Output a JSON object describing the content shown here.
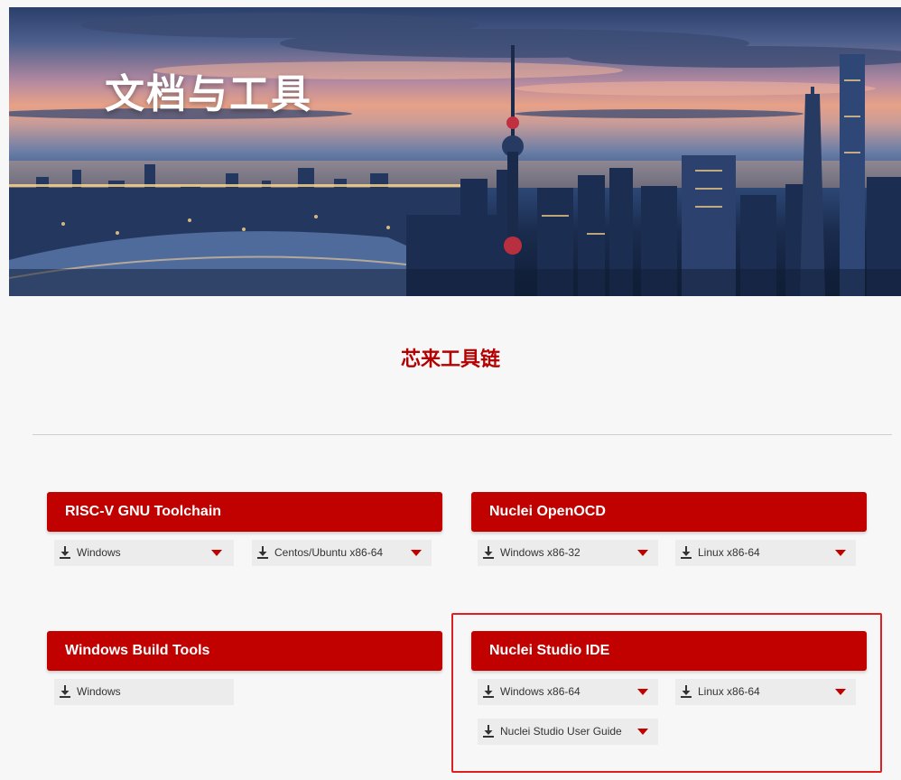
{
  "banner": {
    "title": "文档与工具"
  },
  "section": {
    "title": "芯来工具链"
  },
  "cards": {
    "gnu": {
      "title": "RISC-V GNU Toolchain",
      "buttons": [
        "Windows",
        "Centos/Ubuntu x86-64"
      ]
    },
    "openocd": {
      "title": "Nuclei OpenOCD",
      "buttons": [
        "Windows x86-32",
        "Linux x86-64"
      ]
    },
    "build": {
      "title": "Windows Build Tools",
      "buttons": [
        "Windows"
      ]
    },
    "studio": {
      "title": "Nuclei Studio IDE",
      "buttons": [
        "Windows x86-64",
        "Linux x86-64",
        "Nuclei Studio User Guide"
      ]
    }
  },
  "theme": {
    "accent": "#c10000",
    "title_red": "#b30000",
    "highlight": "#e02020",
    "button_bg": "#ececec"
  },
  "icons": {
    "download": "download-icon",
    "dropdown": "caret-down-icon"
  }
}
